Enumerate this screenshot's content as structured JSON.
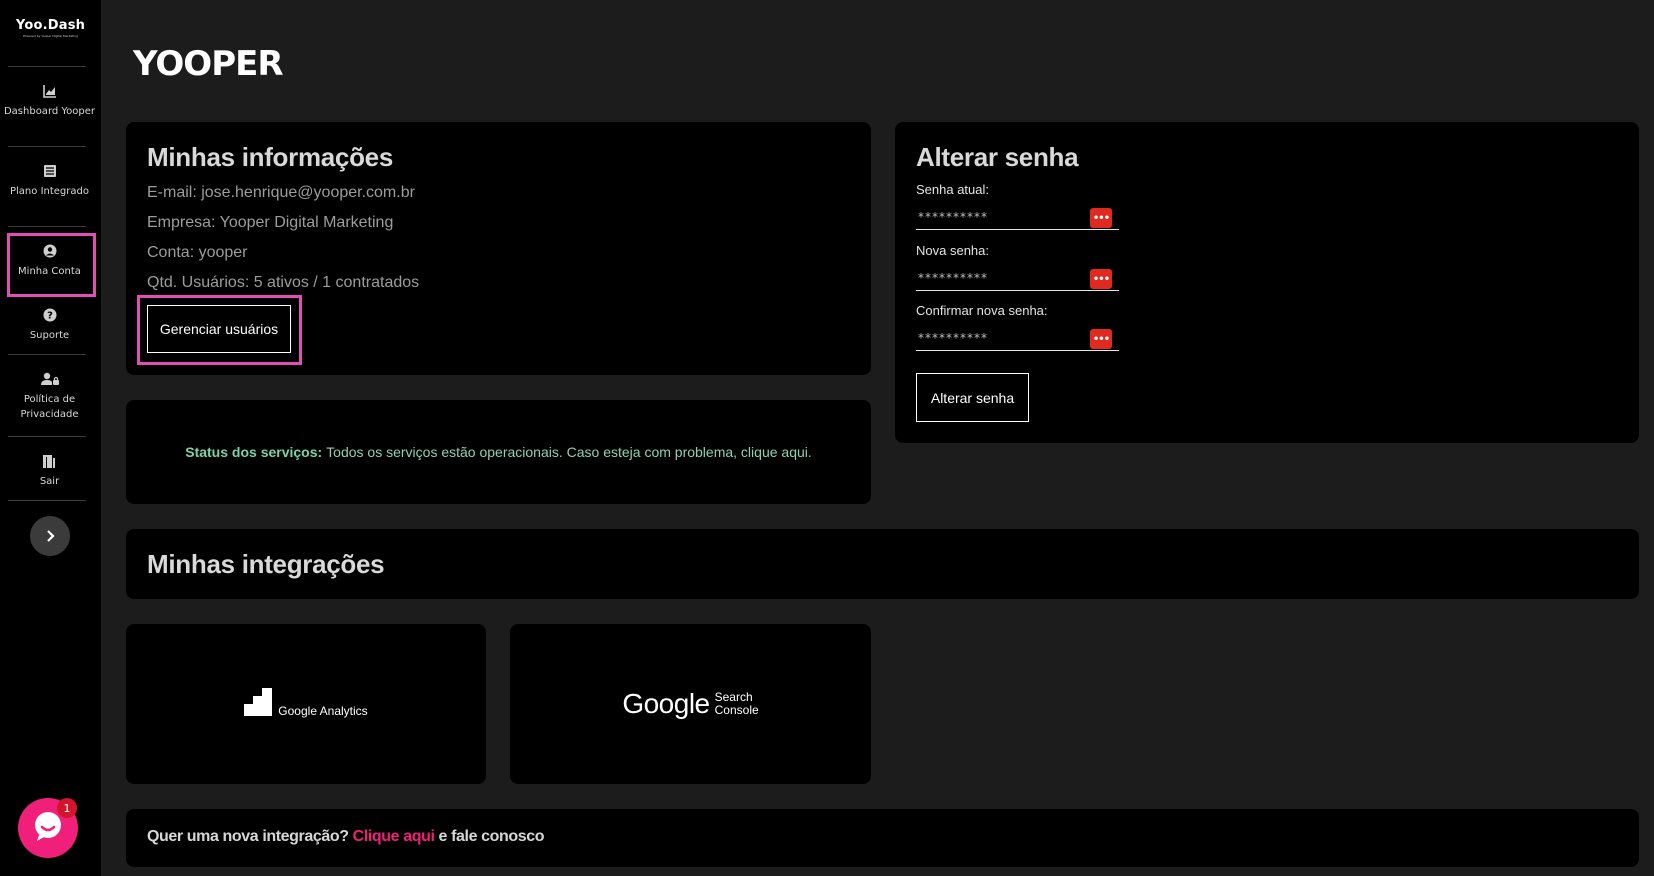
{
  "brand": {
    "name": "Yoo.Dash",
    "tagline": "Powered by Yooper Digital Marketing"
  },
  "sidebar": {
    "items": [
      {
        "label": "Dashboard Yooper",
        "icon": "chart-icon"
      },
      {
        "label": "Plano Integrado",
        "icon": "list-icon"
      },
      {
        "label": "Minha Conta",
        "icon": "user-circle-icon"
      },
      {
        "label": "Suporte",
        "icon": "help-icon"
      },
      {
        "label": "Política de Privacidade",
        "icon": "user-lock-icon"
      },
      {
        "label": "Sair",
        "icon": "exit-door-icon"
      }
    ]
  },
  "chat": {
    "badge": "1"
  },
  "logo": "YOOPER",
  "info": {
    "title": "Minhas informações",
    "email": "E-mail: jose.henrique@yooper.com.br",
    "company": "Empresa: Yooper Digital Marketing",
    "account": "Conta: yooper",
    "users": "Qtd. Usuários: 5 ativos / 1 contratados",
    "manage_button": "Gerenciar usuários"
  },
  "password": {
    "title": "Alterar senha",
    "current_label": "Senha atual:",
    "new_label": "Nova senha:",
    "confirm_label": "Confirmar nova senha:",
    "mask": "**********",
    "submit_button": "Alterar senha"
  },
  "status": {
    "label": "Status dos serviços:",
    "text": "Todos os serviços estão operacionais. Caso esteja com problema, clique aqui."
  },
  "integrations": {
    "title": "Minhas integrações",
    "items": [
      {
        "name": "Google Analytics"
      },
      {
        "name": "Google",
        "sub1": "Search",
        "sub2": "Console"
      }
    ]
  },
  "cta": {
    "prefix": "Quer uma nova integração?",
    "link": "Clique aqui",
    "suffix": "e fale conosco"
  },
  "colors": {
    "accent": "#f01f7a",
    "highlight": "#e04fb3",
    "status": "#8ed1b0"
  }
}
